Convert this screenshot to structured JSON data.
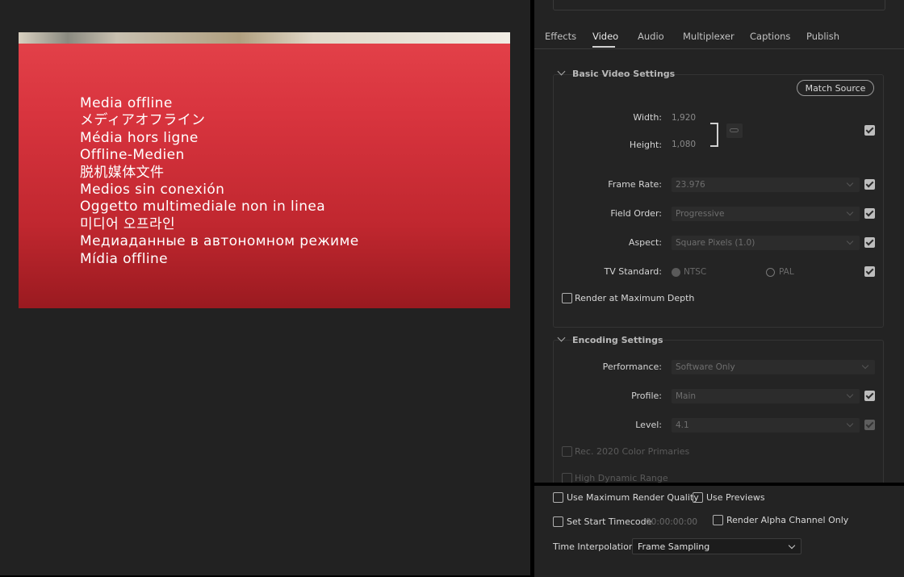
{
  "preview": {
    "offline_text": [
      "Media offline",
      "メディアオフライン",
      "Média hors ligne",
      "Offline-Medien",
      "脱机媒体文件",
      "Medios sin conexión",
      "Oggetto multimediale non in linea",
      "미디어 오프라인",
      "Медиаданные в автономном режиме",
      "Mídia offline"
    ]
  },
  "tabs": [
    {
      "label": "Effects",
      "active": false
    },
    {
      "label": "Video",
      "active": true
    },
    {
      "label": "Audio",
      "active": false
    },
    {
      "label": "Multiplexer",
      "active": false
    },
    {
      "label": "Captions",
      "active": false
    },
    {
      "label": "Publish",
      "active": false
    }
  ],
  "basic_video": {
    "title": "Basic Video Settings",
    "match_source": "Match Source",
    "width_label": "Width:",
    "width_value": "1,920",
    "height_label": "Height:",
    "height_value": "1,080",
    "frame_rate_label": "Frame Rate:",
    "frame_rate_value": "23.976",
    "field_order_label": "Field Order:",
    "field_order_value": "Progressive",
    "aspect_label": "Aspect:",
    "aspect_value": "Square Pixels (1.0)",
    "tv_standard_label": "TV Standard:",
    "tv_ntsc": "NTSC",
    "tv_pal": "PAL",
    "tv_selected": "NTSC",
    "render_max_depth": "Render at Maximum Depth"
  },
  "encoding": {
    "title": "Encoding Settings",
    "performance_label": "Performance:",
    "performance_value": "Software Only",
    "profile_label": "Profile:",
    "profile_value": "Main",
    "level_label": "Level:",
    "level_value": "4.1",
    "rec2020": "Rec. 2020 Color Primaries",
    "hdr": "High Dynamic Range"
  },
  "bottom": {
    "use_max_render_quality": "Use Maximum Render Quality",
    "use_previews": "Use Previews",
    "set_start_timecode": "Set Start Timecode",
    "timecode_value": "00:00:00:00",
    "render_alpha_only": "Render Alpha Channel Only",
    "time_interpolation_label": "Time Interpolation:",
    "time_interpolation_value": "Frame Sampling"
  }
}
